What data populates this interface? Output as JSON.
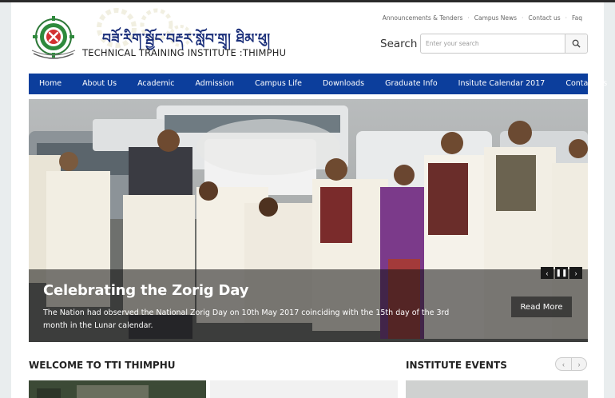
{
  "header": {
    "dzongkha_title": "བཟོ་རིག་སྦྱོང་བརྡར་སློབ་གྲྭ། ཐིམ་ཕུ།",
    "english_title": "TECHNICAL TRAINING INSTITUTE :THIMPHU",
    "top_links": [
      "Announcements & Tenders",
      "Campus News",
      "Contact us",
      "Faq"
    ],
    "search_label": "Search",
    "search_placeholder": "Enter your search",
    "search_icon": "search-icon"
  },
  "nav": {
    "items": [
      "Home",
      "About Us",
      "Academic",
      "Admission",
      "Campus Life",
      "Downloads",
      "Graduate Info",
      "Insitute Calendar 2017",
      "Contact Us"
    ],
    "color": "#0c3e9c"
  },
  "slider": {
    "title": "Celebrating the Zorig Day",
    "text": "The Nation had  observed the National Zorig Day on 10th May 2017 coinciding with the 15th day of the 3rd month in the Lunar calendar.",
    "read_more": "Read More",
    "controls": [
      "chevron-left-icon",
      "pause-icon",
      "chevron-right-icon"
    ]
  },
  "sections": {
    "welcome": "WELCOME TO TTI THIMPHU",
    "events": "INSTITUTE EVENTS"
  }
}
